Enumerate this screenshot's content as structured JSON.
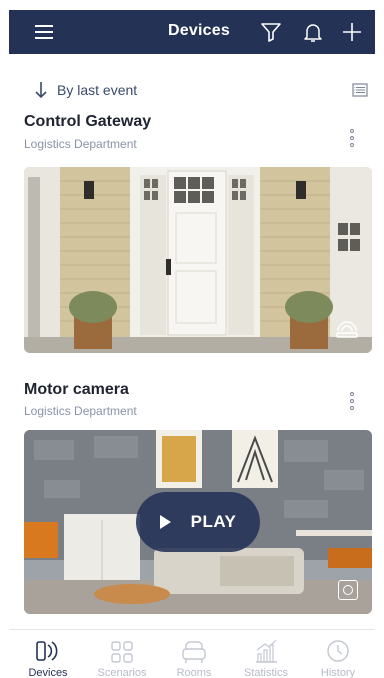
{
  "header": {
    "title": "Devices",
    "icons": [
      "hamburger-menu-icon",
      "filter-icon",
      "bell-icon",
      "plus-icon"
    ],
    "bg_color": "#243256"
  },
  "sort": {
    "label": "By last event",
    "icons": [
      "arrow-down-icon",
      "list-view-icon"
    ]
  },
  "devices": [
    {
      "name": "Control Gateway",
      "location": "Logistics Department",
      "media_type": "snapshot",
      "overlay_icon": "wireless-camera-icon"
    },
    {
      "name": "Motor camera",
      "location": "Logistics Department",
      "media_type": "live",
      "play_label": "PLAY",
      "overlay_icon": "snapshot-icon"
    }
  ],
  "nav": {
    "active_index": 0,
    "items": [
      {
        "label": "Devices",
        "icon": "devices-icon"
      },
      {
        "label": "Scenarios",
        "icon": "scenarios-icon"
      },
      {
        "label": "Rooms",
        "icon": "rooms-icon"
      },
      {
        "label": "Statistics",
        "icon": "statistics-icon"
      },
      {
        "label": "History",
        "icon": "history-icon"
      }
    ]
  }
}
